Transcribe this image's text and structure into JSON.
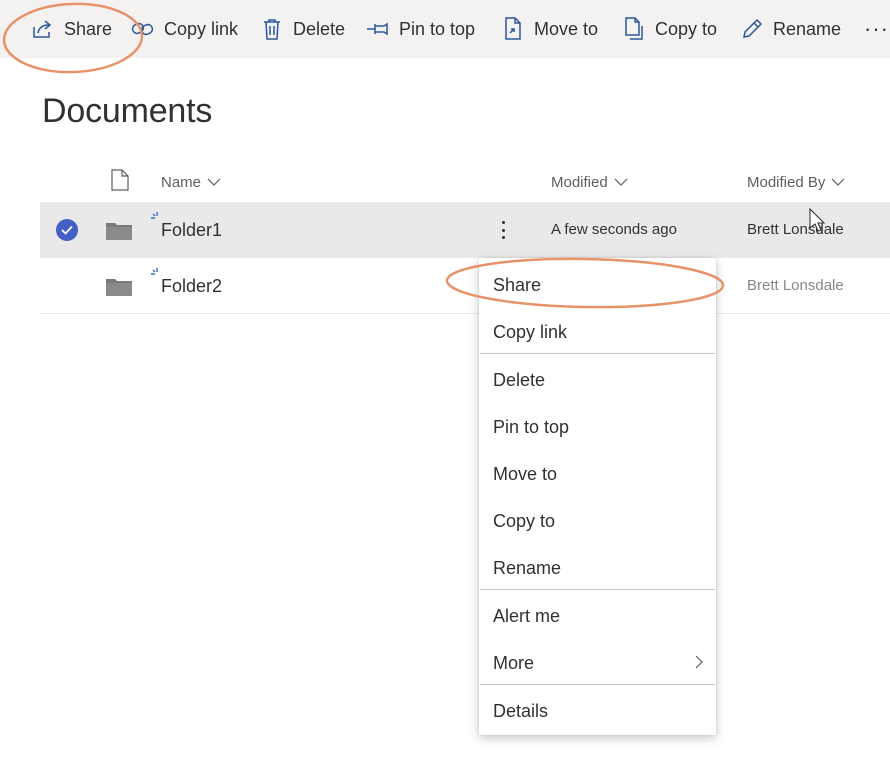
{
  "toolbar": {
    "share_label": "Share",
    "copy_link_label": "Copy link",
    "delete_label": "Delete",
    "pin_to_top_label": "Pin to top",
    "move_to_label": "Move to",
    "copy_to_label": "Copy to",
    "rename_label": "Rename",
    "more_label": "···"
  },
  "page": {
    "title": "Documents"
  },
  "columns": {
    "name": "Name",
    "modified": "Modified",
    "modified_by": "Modified By"
  },
  "rows": [
    {
      "name": "Folder1",
      "modified": "A few seconds ago",
      "modified_by": "Brett Lonsdale",
      "selected": true
    },
    {
      "name": "Folder2",
      "modified": "",
      "modified_by": "Brett Lonsdale",
      "selected": false
    }
  ],
  "context_menu": {
    "items": [
      {
        "label": "Share"
      },
      {
        "label": "Copy link"
      },
      {
        "label": "Delete"
      },
      {
        "label": "Pin to top"
      },
      {
        "label": "Move to"
      },
      {
        "label": "Copy to"
      },
      {
        "label": "Rename"
      },
      {
        "label": "Alert me"
      },
      {
        "label": "More"
      },
      {
        "label": "Details"
      }
    ]
  },
  "colors": {
    "accent": "#4460c6",
    "annotation": "#e8926a",
    "toolbar_bg": "#f3f2f1",
    "selected_row_bg": "#e9e9e9"
  },
  "icons": {
    "toolbar": [
      "share-icon",
      "link-icon",
      "trash-icon",
      "pin-icon",
      "move-icon",
      "copy-icon",
      "pencil-icon",
      "more-icon"
    ],
    "rows": [
      "checkmark-icon",
      "folder-icon",
      "new-item-icon",
      "more-vertical-icon"
    ]
  }
}
